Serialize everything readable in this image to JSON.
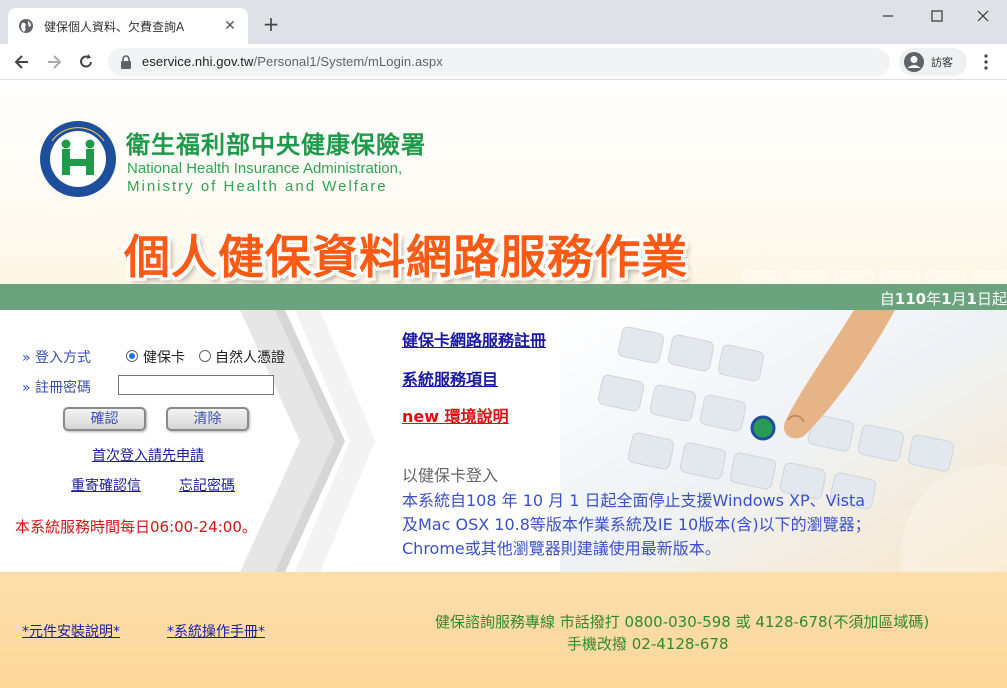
{
  "browser": {
    "tab_title": "健保個人資料、欠費查詢A",
    "url_host": "eservice.nhi.gov.tw",
    "url_path": "/Personal1/System/mLogin.aspx",
    "profile_label": "訪客"
  },
  "header": {
    "org_name_zh": "衛生福利部中央健康保險署",
    "org_name_en_line1": "National Health Insurance Administration,",
    "org_name_en_line2": "Ministry of Health and Welfare",
    "service_title": "個人健保資料網路服務作業",
    "ticker_prefix": "自",
    "ticker_year": "110",
    "ticker_year_unit": "年",
    "ticker_month": "1",
    "ticker_month_unit": "月",
    "ticker_day": "1",
    "ticker_day_unit": "日起"
  },
  "login": {
    "method_label": "登入方式",
    "option_card": "健保卡",
    "option_cert": "自然人憑證",
    "password_label": "註冊密碼",
    "password_value": "",
    "confirm_button": "確認",
    "clear_button": "清除",
    "first_login_link": "首次登入請先申請",
    "resend_link": "重寄確認信",
    "forgot_link": "忘記密碼",
    "service_hours": "本系統服務時間每日06:00-24:00。"
  },
  "menu": {
    "register_link": "健保卡網路服務註冊",
    "services_link": "系統服務項目",
    "new_badge": "new",
    "env_link": "環境說明"
  },
  "notice": {
    "heading": "以健保卡登入",
    "line1": "本系統自108 年 10 月 1 日起全面停止支援Windows XP、Vista",
    "line2": "及Mac OSX 10.8等版本作業系統及IE 10版本(含)以下的瀏覽器；",
    "line3": "Chrome或其他瀏覽器則建議使用最新版本。"
  },
  "footer": {
    "install_link": "*元件安裝說明*",
    "manual_link": "*系統操作手冊*",
    "hotline_line1": "健保諮詢服務專線 市話撥打 0800-030-598 或 4128-678(不須加區域碼)",
    "hotline_line2": "手機改撥 02-4128-678"
  },
  "colors": {
    "brand_green": "#1e9a4a",
    "bar_green": "#6aa37d",
    "title_orange": "#ff5a14",
    "link_blue": "#1a1aa6",
    "alert_red": "#d41414"
  }
}
